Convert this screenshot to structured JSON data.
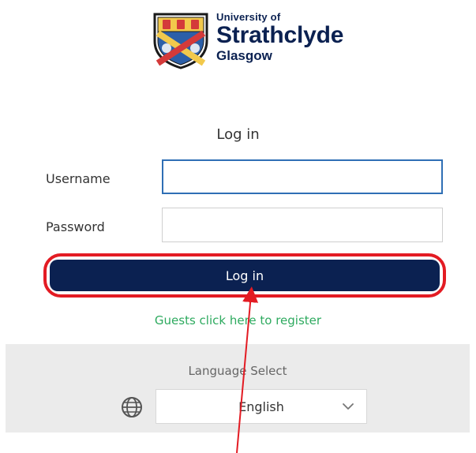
{
  "logo": {
    "line1": "University of",
    "line2": "Strathclyde",
    "line3": "Glasgow"
  },
  "login": {
    "heading": "Log in",
    "username_label": "Username",
    "password_label": "Password",
    "username_value": "",
    "password_value": "",
    "submit_label": "Log in",
    "register_link": "Guests click here to register"
  },
  "language": {
    "title": "Language Select",
    "selected": "English"
  },
  "icons": {
    "globe": "globe-icon",
    "chevron": "chevron-down-icon",
    "arrow": "annotation-arrow-icon"
  },
  "colors": {
    "brand_navy": "#0b2151",
    "link_green": "#2eaa5f",
    "focus_blue": "#2f6fb5",
    "annotation_red": "#e31b23",
    "panel_gray": "#ebebeb"
  }
}
